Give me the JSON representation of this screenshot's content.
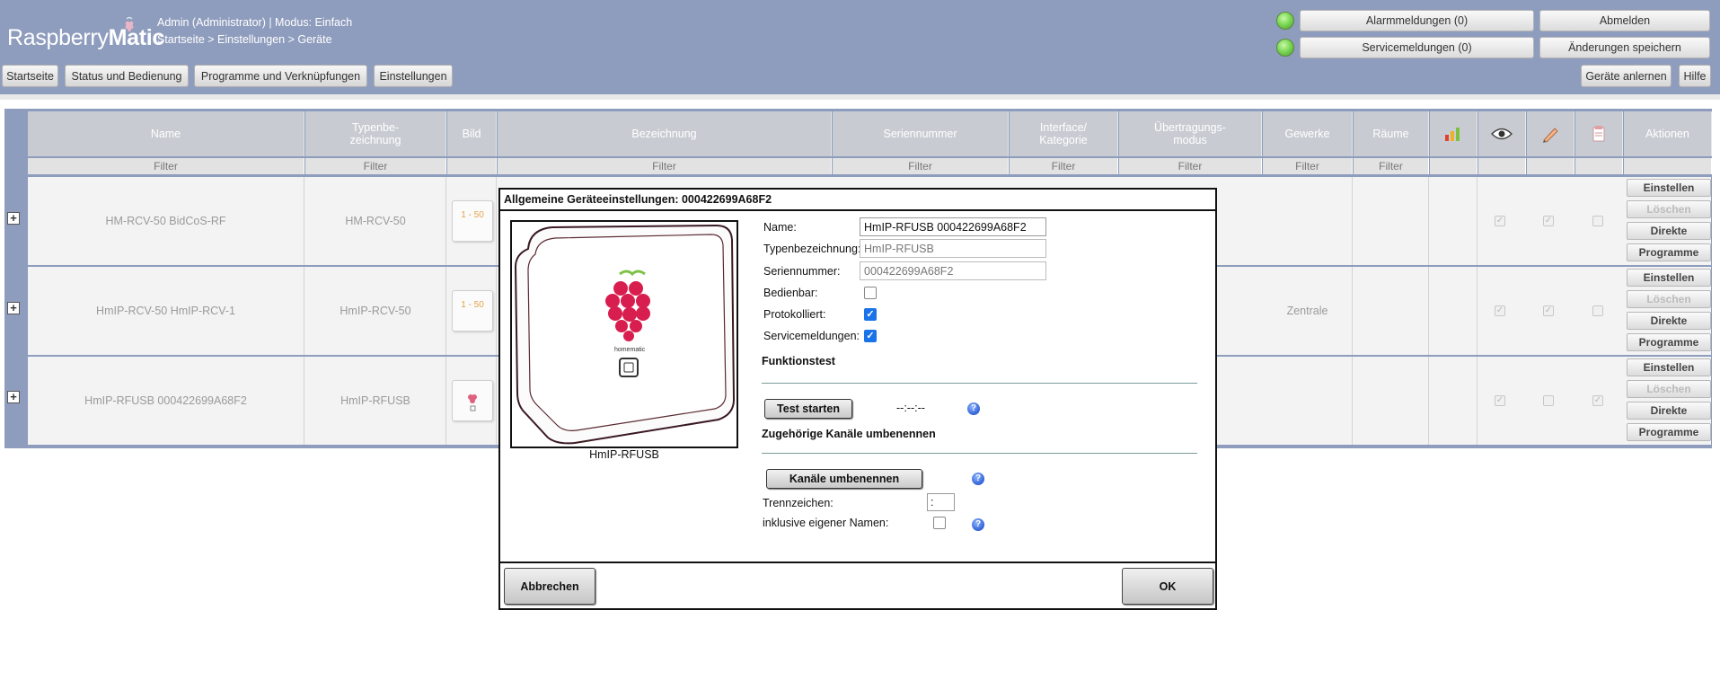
{
  "header": {
    "logo_part1": "Raspberry",
    "logo_part2": "Matic",
    "user_info": "Admin (Administrator) | Modus: Einfach",
    "breadcrumb": "Startseite > Einstellungen > Geräte",
    "alarm_button": "Alarmmeldungen (0)",
    "service_button": "Servicemeldungen (0)",
    "logout_button": "Abmelden",
    "save_changes_button": "Änderungen speichern",
    "nav": [
      "Startseite",
      "Status und Bedienung",
      "Programme und Verknüpfungen",
      "Einstellungen"
    ],
    "teach_devices_button": "Geräte anlernen",
    "help_button": "Hilfe"
  },
  "table": {
    "columns": {
      "name": "Name",
      "type": "Typenbe-\nzeichnung",
      "image": "Bild",
      "description": "Bezeichnung",
      "serial": "Seriennummer",
      "interface": "Interface/\nKategorie",
      "transfer": "Übertragungs-\nmodus",
      "trades": "Gewerke",
      "rooms": "Räume",
      "actions": "Aktionen"
    },
    "filter_label": "Filter",
    "rows": [
      {
        "name": "HM-RCV-50 BidCoS-RF",
        "type": "HM-RCV-50",
        "thumb_label": "1 - 50",
        "trades": "",
        "checks": [
          true,
          true,
          false
        ]
      },
      {
        "name": "HmIP-RCV-50 HmIP-RCV-1",
        "type": "HmIP-RCV-50",
        "thumb_label": "1 - 50",
        "trades": "Zentrale",
        "checks": [
          true,
          true,
          false
        ]
      },
      {
        "name": "HmIP-RFUSB 000422699A68F2",
        "type": "HmIP-RFUSB",
        "thumb_label": "",
        "trades": "",
        "checks": [
          true,
          false,
          true
        ]
      }
    ],
    "actions": {
      "settings": "Einstellen",
      "delete": "Löschen",
      "direct": "Direkte",
      "programs": "Programme"
    }
  },
  "dialog": {
    "title": "Allgemeine Geräteeinstellungen: 000422699A68F2",
    "image_caption": "HmIP-RFUSB",
    "image_brand": "homematic",
    "labels": {
      "name": "Name:",
      "type": "Typenbezeichnung:",
      "serial": "Seriennummer:",
      "operable": "Bedienbar:",
      "logged": "Protokolliert:",
      "service_messages": "Servicemeldungen:"
    },
    "values": {
      "name": "HmIP-RFUSB 000422699A68F2",
      "type": "HmIP-RFUSB",
      "serial": "000422699A68F2",
      "operable": false,
      "logged": true,
      "service_messages": true
    },
    "function_test": {
      "title": "Funktionstest",
      "button": "Test starten",
      "time": "--:--:--"
    },
    "rename_channels": {
      "title": "Zugehörige Kanäle umbenennen",
      "button": "Kanäle umbenennen",
      "separator_label": "Trennzeichen:",
      "separator_value": ":",
      "own_names_label": "inklusive eigener Namen:",
      "own_names": false
    },
    "cancel_button": "Abbrechen",
    "ok_button": "OK"
  },
  "colors": {
    "header_bg": "#8e9cbd",
    "status_led": "#7ed957",
    "checkbox_checked": "#1a73e8"
  }
}
